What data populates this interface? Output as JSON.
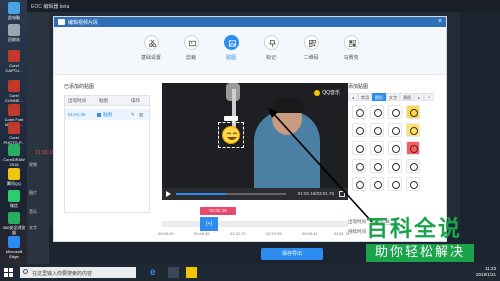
{
  "desktop": {
    "icons": [
      {
        "label": "此电脑",
        "color": "#4aa3df"
      },
      {
        "label": "回收站",
        "color": "#9aa7b3"
      },
      {
        "label": "Corel CAPTU...",
        "color": "#c0392b"
      },
      {
        "label": "Corel CONNE...",
        "color": "#c0392b"
      },
      {
        "label": "Corel Font Manage...",
        "color": "#c0392b"
      },
      {
        "label": "Corel PHOTO-P...",
        "color": "#c0392b"
      },
      {
        "label": "CorelDRAW 2018",
        "color": "#27ae60"
      },
      {
        "label": "腾讯QQ",
        "color": "#f1c40f"
      },
      {
        "label": "微信",
        "color": "#2ecc71"
      },
      {
        "label": "360安全浏览器",
        "color": "#27ae60"
      },
      {
        "label": "Microsoft Edge",
        "color": "#2d8cf0"
      }
    ]
  },
  "bgapp": {
    "title": "EOC 编辑器 beta",
    "side_items": [
      "视频",
      "图片",
      "音乐",
      "文字"
    ],
    "timecode": "01:02.16",
    "save_export": "保存导出"
  },
  "dialog": {
    "title": "编辑视频片段",
    "tools": [
      {
        "label": "基础设置",
        "icon": "scissors-icon",
        "active": false
      },
      {
        "label": "剪裁",
        "icon": "crop-icon",
        "active": false
      },
      {
        "label": "贴图",
        "icon": "image-icon",
        "active": true
      },
      {
        "label": "标记",
        "icon": "pin-icon",
        "active": false
      },
      {
        "label": "二维码",
        "icon": "qrcode-icon",
        "active": false
      },
      {
        "label": "马赛克",
        "icon": "mosaic-icon",
        "active": false
      }
    ],
    "left_panel": {
      "title": "已添加的贴图",
      "columns": [
        "出现时间",
        "贴图",
        "操作"
      ],
      "rows": [
        {
          "time": "01:01.45",
          "type": "贴图"
        }
      ]
    },
    "video": {
      "watermark": "QQ音乐",
      "time": "01:02.16/03:51.76",
      "progress": 0.45
    },
    "timeline": {
      "marker": "01:02.16",
      "segment": "[+]",
      "ticks": [
        "00:00.00",
        "00:46.35",
        "01:32.70",
        "02:19.05",
        "03:05.41",
        "03:51.76"
      ]
    },
    "right_panel": {
      "title": "添加贴图",
      "tabs": [
        "常用",
        "图形",
        "文字",
        "潮图"
      ],
      "stickers": [
        {
          "color": "#ffffff",
          "name": "angry-face"
        },
        {
          "color": "#ffffff",
          "name": "cry-face"
        },
        {
          "color": "#ffffff",
          "name": "heart-face"
        },
        {
          "color": "#ffd84a",
          "name": "happy-face"
        },
        {
          "color": "#ffffff",
          "name": "sweat-face"
        },
        {
          "color": "#ffffff",
          "name": "laugh-face"
        },
        {
          "color": "#ffffff",
          "name": "love-eyes"
        },
        {
          "color": "#ffe26a",
          "name": "smile-face"
        },
        {
          "color": "#ffffff",
          "name": "speech-bubble"
        },
        {
          "color": "#ffffff",
          "name": "thought-bubble"
        },
        {
          "color": "#ffffff",
          "name": "shout-bubble"
        },
        {
          "color": "#ff5a5a",
          "name": "heart"
        },
        {
          "color": "#ffffff",
          "name": "surprise"
        },
        {
          "color": "#ffffff",
          "name": "dizzy"
        },
        {
          "color": "#ffffff",
          "name": "cloud"
        },
        {
          "color": "#f7f7f7",
          "name": "sleepy"
        },
        {
          "color": "#ffffff",
          "name": "balloon"
        },
        {
          "color": "#ffffff",
          "name": "cat"
        },
        {
          "color": "#ffffff",
          "name": "star-text"
        },
        {
          "color": "#ffffff",
          "name": "bunny"
        }
      ],
      "appear_label": "出现时间",
      "appear_value": "01:01.45",
      "duration_label": "持续时间"
    }
  },
  "taskbar": {
    "search_placeholder": "在这里输入你要搜索的内容",
    "time": "11:23",
    "date": "2019/1/21"
  },
  "brand": {
    "title": "百科全说",
    "subtitle": "助你轻松解决"
  }
}
